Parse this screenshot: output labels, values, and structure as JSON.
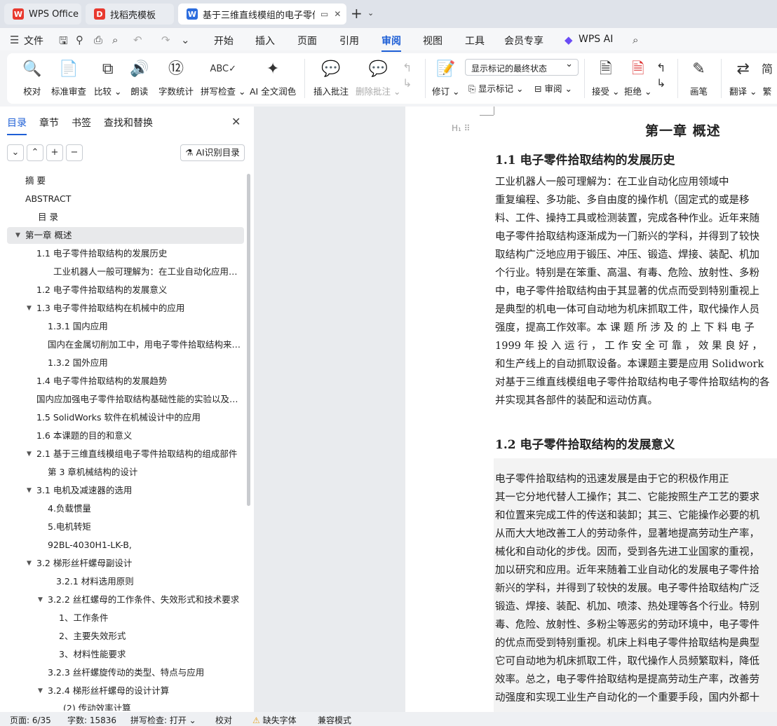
{
  "tabs": [
    {
      "label": "WPS Office",
      "icon": "wps-logo-icon"
    },
    {
      "label": "找稻壳模板",
      "icon": "docer-icon"
    },
    {
      "label": "基于三维直线模组的电子零件",
      "icon": "writer-doc-icon"
    }
  ],
  "menu": {
    "file": "文件",
    "items": [
      "开始",
      "插入",
      "页面",
      "引用",
      "审阅",
      "视图",
      "工具",
      "会员专享"
    ],
    "active": "审阅",
    "wps_ai": "WPS AI"
  },
  "ribbon": {
    "proofread": "校对",
    "standard_review": "标准审查",
    "compare": "比较",
    "read_aloud": "朗读",
    "word_count": "字数统计",
    "spell_check": "拼写检查",
    "ai_polish": "AI 全文润色",
    "insert_comment": "插入批注",
    "delete_comment": "删除批注",
    "track_changes": "修订",
    "display_mode": "显示标记的最终状态",
    "show_markup": "显示标记",
    "review_pane": "审阅",
    "accept": "接受",
    "reject": "拒绝",
    "pen": "画笔",
    "translate": "翻译",
    "traditional": "繁"
  },
  "sidebar": {
    "tabs": [
      "目录",
      "章节",
      "书签",
      "查找和替换"
    ],
    "active_tab": "目录",
    "ai_button": "AI识别目录",
    "toc": [
      {
        "label": "摘  要",
        "level": 0
      },
      {
        "label": "ABSTRACT",
        "level": 0
      },
      {
        "label": "目  录",
        "level": 1
      },
      {
        "label": "第一章  概述",
        "level": 0,
        "expanded": true,
        "selected": true
      },
      {
        "label": "1.1 电子零件拾取结构的发展历史",
        "level": 1
      },
      {
        "label": "工业机器人一般可理解为：在工业自动化应用领域中，",
        "level": 3
      },
      {
        "label": "1.2 电子零件拾取结构的发展意义",
        "level": 1
      },
      {
        "label": "1.3  电子零件拾取结构在机械中的应用",
        "level": 1,
        "expanded": true
      },
      {
        "label": "1.3.1  国内应用",
        "level": 2
      },
      {
        "label": "国内在金属切削加工中，用电子零件拾取结构来完成",
        "level": 2
      },
      {
        "label": "1.3.2  国外应用",
        "level": 2
      },
      {
        "label": "1.4 电子零件拾取结构的发展趋势",
        "level": 1
      },
      {
        "label": "国内应加强电子零件拾取结构基础性能的实验以及基础",
        "level": 1
      },
      {
        "label": "1.5 SolidWorks 软件在机械设计中的应用",
        "level": 1
      },
      {
        "label": "1.6 本课题的目的和意义",
        "level": 1
      },
      {
        "label": "2.1 基于三维直线模组电子零件拾取结构的组成部件",
        "level": 1,
        "expanded": true
      },
      {
        "label": "第 3 章机械结构的设计",
        "level": 2
      },
      {
        "label": "3.1 电机及减速器的选用",
        "level": 1,
        "expanded": true
      },
      {
        "label": "4.负载惯量",
        "level": 2
      },
      {
        "label": "5.电机转矩",
        "level": 2
      },
      {
        "label": "92BL-4030H1-LK-B,",
        "level": 2
      },
      {
        "label": "3.2 梯形丝杆螺母副设计",
        "level": 1,
        "expanded": true
      },
      {
        "label": "3.2.1 材料选用原则",
        "level": 3
      },
      {
        "label": "3.2.2 丝杠螺母的工作条件、失效形式和技术要求",
        "level": 2,
        "expanded": true
      },
      {
        "label": "1、工作条件",
        "level": 3
      },
      {
        "label": "2、主要失效形式",
        "level": 3
      },
      {
        "label": "3、材料性能要求",
        "level": 3
      },
      {
        "label": "3.2.3 丝杆螺旋传动的类型、特点与应用",
        "level": 2
      },
      {
        "label": "3.2.4 梯形丝杆螺母的设计计算",
        "level": 2,
        "expanded": true
      },
      {
        "label": "(2) 传动效率计算",
        "level": 3
      }
    ]
  },
  "document": {
    "chapter_title": "第一章    概述",
    "section1_title": "1.1 电子零件拾取结构的发展历史",
    "section1_lines": [
      "    工业机器人一般可理解为：在工业自动化应用领域中",
      "重复编程、多功能、多自由度的操作机（固定式的或是移",
      "料、工件、操持工具或检测装置，完成各种作业。近年来随",
      "电子零件拾取结构逐渐成为一门新兴的学科，并得到了较快",
      "取结构广泛地应用于锻压、冲压、锻造、焊接、装配、机加",
      "个行业。特别是在笨重、高温、有毒、危险、放射性、多粉",
      "中，电子零件拾取结构由于其显著的优点而受到特别重视上",
      "是典型的机电一体可自动地为机床抓取工件，取代操作人员",
      "强度，提高工作效率。本 课 题 所 涉 及 的 上 下 料 电 子",
      "1999 年 投 入 运 行 ， 工 作 安 全 可 靠 ， 效 果 良 好 ，",
      "和生产线上的自动抓取设备。本课题主要是应用 Solidwork",
      "对基于三维直线模组电子零件拾取结构电子零件拾取结构的各",
      "并实现其各部件的装配和运动仿真。"
    ],
    "section2_title": "1.2 电子零件拾取结构的发展意义",
    "section2_lines": [
      "    电子零件拾取结构的迅速发展是由于它的积极作用正",
      "其一它分地代替人工操作；其二、它能按照生产工艺的要求",
      "和位置来完成工件的传送和装卸；其三、它能操作必要的机",
      "从而大大地改善工人的劳动条件，显著地提高劳动生产率，",
      "械化和自动化的步伐。因而，受到各先进工业国家的重视，",
      "加以研究和应用。近年来随着工业自动化的发展电子零件拾",
      "新兴的学科，并得到了较快的发展。电子零件拾取结构广泛",
      "锻造、焊接、装配、机加、喷漆、热处理等各个行业。特别",
      "毒、危险、放射性、多粉尘等恶劣的劳动环境中，电子零件",
      "的优点而受到特别重视。机床上料电子零件拾取结构是典型",
      "它可自动地为机床抓取工件，取代操作人员频繁取料，降低",
      "效率。总之，电子零件拾取结构是提高劳动生产率，改善劳",
      "动强度和实现工业生产自动化的一个重要手段，国内外都十"
    ]
  },
  "status": {
    "page": "页面: 6/35",
    "word_count": "字数: 15836",
    "spell_check": "拼写检查: 打开",
    "proofread": "校对",
    "missing_font": "缺失字体",
    "compat_mode": "兼容模式"
  },
  "colors": {
    "accent": "#1e5fd6",
    "wps_red": "#e8392f",
    "writer_blue": "#2b6cde"
  }
}
